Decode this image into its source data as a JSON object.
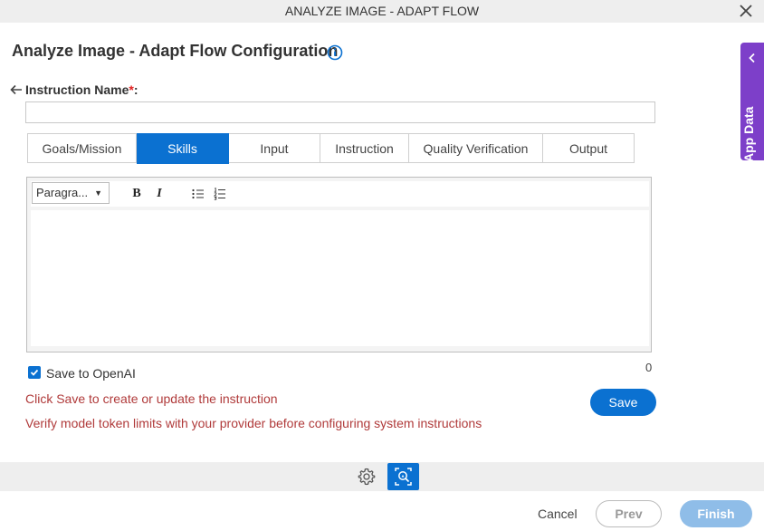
{
  "window": {
    "title": "ANALYZE IMAGE - ADAPT FLOW"
  },
  "page": {
    "title": "Analyze Image - Adapt Flow Configuration"
  },
  "instruction": {
    "label": "Instruction Name",
    "required_mark": "*",
    "suffix": ":",
    "value": ""
  },
  "tabs": [
    {
      "label": "Goals/Mission",
      "active": false
    },
    {
      "label": "Skills",
      "active": true
    },
    {
      "label": "Input",
      "active": false
    },
    {
      "label": "Instruction",
      "active": false
    },
    {
      "label": "Quality Verification",
      "active": false
    },
    {
      "label": "Output",
      "active": false
    }
  ],
  "editor": {
    "paragraph_select": "Paragra...",
    "bold": "B",
    "italic": "I",
    "content": ""
  },
  "save_to_openai": {
    "label": "Save to OpenAI",
    "checked": true
  },
  "char_count": "0",
  "messages": {
    "save_hint": "Click Save to create or update the instruction",
    "token_warning": "Verify model token limits with your provider before configuring system instructions"
  },
  "buttons": {
    "save": "Save",
    "cancel": "Cancel",
    "prev": "Prev",
    "finish": "Finish"
  },
  "side_panel": {
    "label": "App Data"
  },
  "icons": [
    "close-icon",
    "info-icon",
    "back-arrow-icon",
    "bulleted-list-icon",
    "numbered-list-icon",
    "chevron-left-icon",
    "gear-icon",
    "image-scan-icon",
    "checkmark-icon"
  ],
  "colors": {
    "accent": "#0b71d1",
    "side_panel": "#7d3fc9",
    "warning_text": "#b03a3a",
    "finish_disabled": "#8fbde8"
  }
}
